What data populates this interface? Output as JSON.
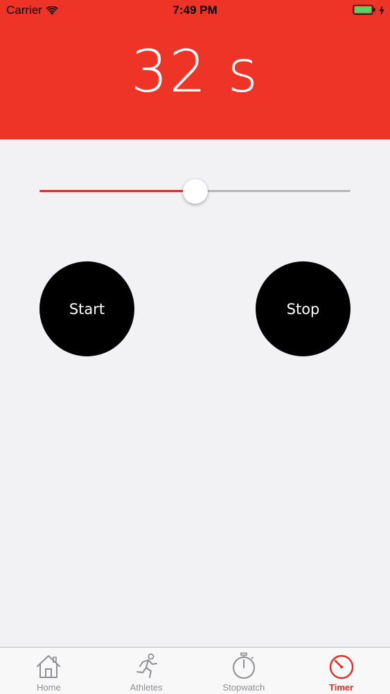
{
  "status_bar": {
    "carrier": "Carrier",
    "time": "7:49 PM"
  },
  "header": {
    "timer_value": "32 s"
  },
  "slider": {
    "value_fraction": 0.5,
    "fill_color": "#df2a27"
  },
  "controls": {
    "start_label": "Start",
    "stop_label": "Stop"
  },
  "tab_bar": {
    "items": [
      {
        "label": "Home",
        "icon": "home-icon"
      },
      {
        "label": "Athletes",
        "icon": "runner-icon"
      },
      {
        "label": "Stopwatch",
        "icon": "stopwatch-icon"
      },
      {
        "label": "Timer",
        "icon": "timer-icon",
        "active": true
      }
    ]
  },
  "colors": {
    "header_red": "#ee3427",
    "active_tab": "#e22b22",
    "inactive_tab": "#8e8e93",
    "button_black": "#000000",
    "background": "#f2f1f4"
  }
}
